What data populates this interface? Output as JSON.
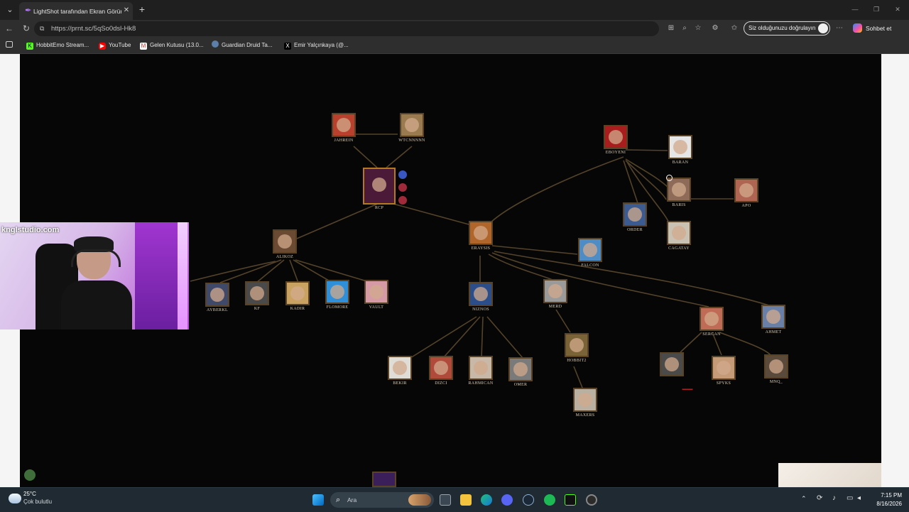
{
  "browser": {
    "tab_title": "LightShot tarafından Ekran Görüntüsü",
    "url": "https://prnt.sc/5qSo0dsl-Hk8",
    "signin_label": "Siz olduğunuzu doğrulayın",
    "chat_label": "Sohbet et",
    "bookmarks": [
      "HobbitEmo Stream...",
      "YouTube",
      "Gelen Kutusu (13.0...",
      "Guardian Druid Ta...",
      "Emir Yalçınkaya (@..."
    ]
  },
  "tree": {
    "nodes": [
      {
        "id": "jahrein",
        "label": "JAHREIN",
        "color": "#b8402c"
      },
      {
        "id": "wtcnnnn",
        "label": "WTCNNNNN",
        "color": "#9a7b4f"
      },
      {
        "id": "rcp",
        "label": "RCP",
        "color": "#8a2a4a"
      },
      {
        "id": "eboyeni",
        "label": "EBOYENI",
        "color": "#a81d1d"
      },
      {
        "id": "baran",
        "label": "BARAN",
        "color": "#e6e6e6"
      },
      {
        "id": "baris",
        "label": "BARIS",
        "color": "#8d6b58"
      },
      {
        "id": "apo",
        "label": "APO",
        "color": "#b06452"
      },
      {
        "id": "order",
        "label": "ORDER",
        "color": "#3b5b91"
      },
      {
        "id": "cagatay",
        "label": "CAGATAY",
        "color": "#c9c2b3"
      },
      {
        "id": "erayyis",
        "label": "ERAYSIS",
        "color": "#b0652a"
      },
      {
        "id": "falcon",
        "label": "FALCON",
        "color": "#4d8cc4"
      },
      {
        "id": "alikoz",
        "label": "ALIKOZ",
        "color": "#6b4a33"
      },
      {
        "id": "ayberkl",
        "label": "AYBERKL",
        "color": "#3f4a6b"
      },
      {
        "id": "kf",
        "label": "KF",
        "color": "#4a4a4a"
      },
      {
        "id": "kadir",
        "label": "KADIR",
        "color": "#c9a261"
      },
      {
        "id": "flomore",
        "label": "FLOMORE",
        "color": "#2f8fd8"
      },
      {
        "id": "vault",
        "label": "VAULT",
        "color": "#d59aa6"
      },
      {
        "id": "niznos",
        "label": "NIZNOS",
        "color": "#2b4e8a"
      },
      {
        "id": "merd",
        "label": "MERD",
        "color": "#9a9a9a"
      },
      {
        "id": "sercan",
        "label": "SERCAN",
        "color": "#c06b55"
      },
      {
        "id": "ahmet",
        "label": "AHMET",
        "color": "#6a7fa6"
      },
      {
        "id": "bekir",
        "label": "BEKIR",
        "color": "#e0dcd6"
      },
      {
        "id": "dizci",
        "label": "DIZCI",
        "color": "#b04a3a"
      },
      {
        "id": "rahmican",
        "label": "RAHMICAN",
        "color": "#c8b8a8"
      },
      {
        "id": "omer",
        "label": "OMER",
        "color": "#7a7a7a"
      },
      {
        "id": "hobbit2",
        "label": "HOBBIT2",
        "color": "#7b6338"
      },
      {
        "id": "maxers",
        "label": "MAXERS",
        "color": "#b9b0a1"
      },
      {
        "id": "redname",
        "label": "",
        "color": "#4a4a4a"
      },
      {
        "id": "spyks",
        "label": "SPYKS",
        "color": "#c49a77"
      },
      {
        "id": "mnq",
        "label": "MNQ_",
        "color": "#5a4a3c"
      }
    ]
  },
  "webcam": {
    "watermark": "knglstudio.com"
  },
  "taskbar": {
    "temperature": "25°C",
    "weather": "Çok bulutlu",
    "search_placeholder": "Ara",
    "time": "7:15 PM",
    "date": "8/16/2026"
  }
}
